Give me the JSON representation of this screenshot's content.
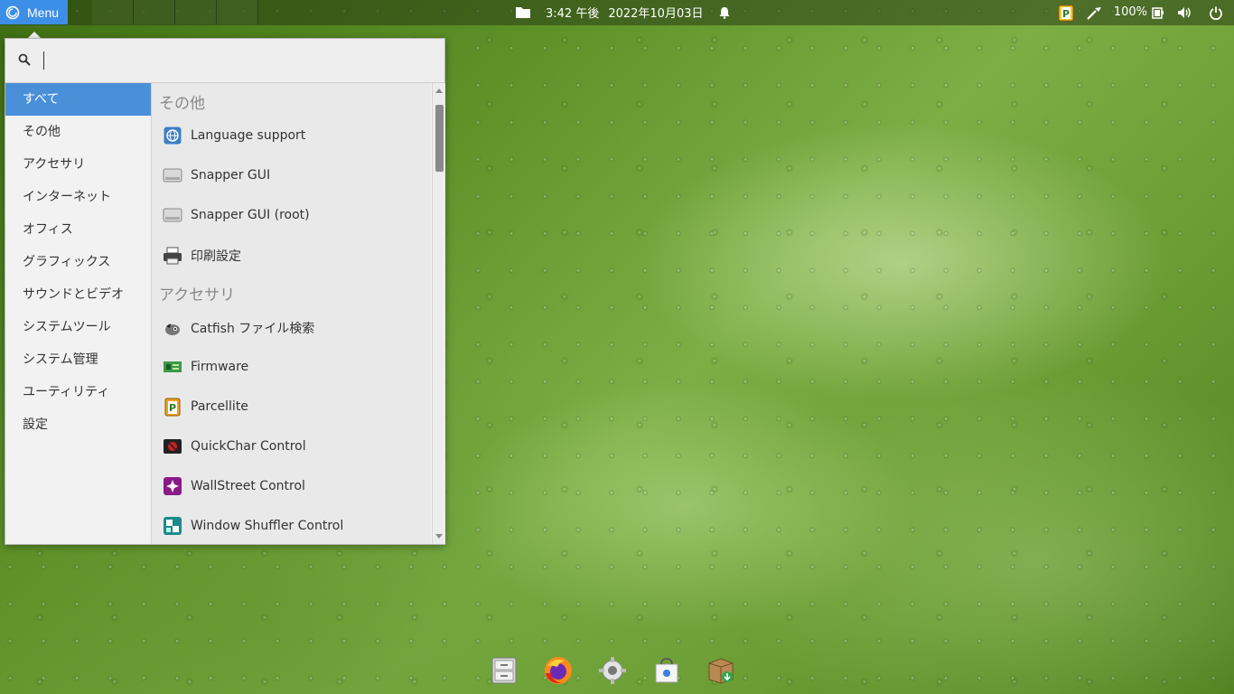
{
  "top_panel": {
    "menu_label": "Menu",
    "time": "3:42 午後",
    "date": "2022年10月03日",
    "battery_percent": "100%"
  },
  "menu": {
    "search": {
      "value": "",
      "placeholder": ""
    },
    "categories": [
      {
        "label": "すべて",
        "active": true
      },
      {
        "label": "その他"
      },
      {
        "label": "アクセサリ"
      },
      {
        "label": "インターネット"
      },
      {
        "label": "オフィス"
      },
      {
        "label": "グラフィックス"
      },
      {
        "label": "サウンドとビデオ"
      },
      {
        "label": "システムツール"
      },
      {
        "label": "システム管理"
      },
      {
        "label": "ユーティリティ"
      },
      {
        "label": "設定"
      }
    ],
    "sections": [
      {
        "header": "その他",
        "items": [
          {
            "label": "Language support",
            "icon": "language-icon"
          },
          {
            "label": "Snapper GUI",
            "icon": "drive-icon"
          },
          {
            "label": "Snapper GUI (root)",
            "icon": "drive-icon"
          },
          {
            "label": "印刷設定",
            "icon": "printer-icon"
          }
        ]
      },
      {
        "header": "アクセサリ",
        "items": [
          {
            "label": "Catfish ファイル検索",
            "icon": "catfish-icon"
          },
          {
            "label": "Firmware",
            "icon": "chip-icon"
          },
          {
            "label": "Parcellite",
            "icon": "clipboard-icon"
          },
          {
            "label": "QuickChar Control",
            "icon": "quickchar-icon"
          },
          {
            "label": "WallStreet Control",
            "icon": "wallstreet-icon"
          },
          {
            "label": "Window Shuffler Control",
            "icon": "window-shuffler-icon"
          }
        ]
      }
    ]
  },
  "dock": [
    {
      "name": "file-cabinet-icon"
    },
    {
      "name": "firefox-icon"
    },
    {
      "name": "settings-gear-icon"
    },
    {
      "name": "software-store-icon"
    },
    {
      "name": "package-installer-icon"
    }
  ],
  "colors": {
    "accent": "#4a90d9",
    "menu_button": "#3d8ee6"
  }
}
